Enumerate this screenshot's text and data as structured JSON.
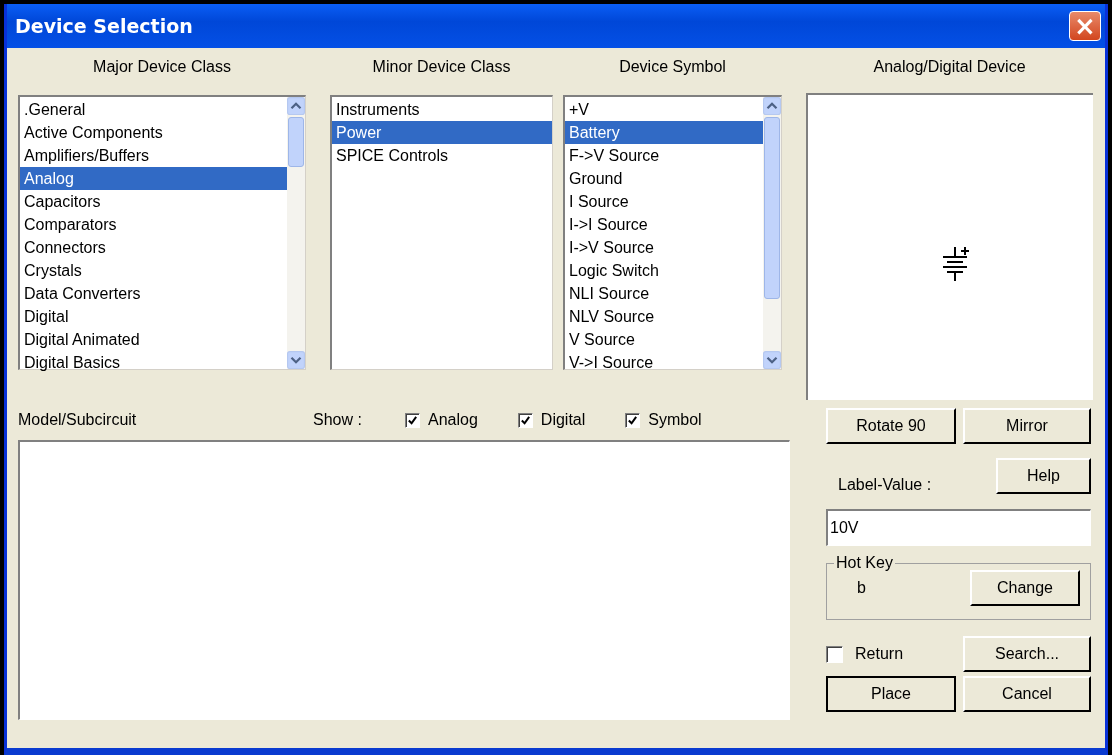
{
  "window": {
    "title": "Device Selection",
    "close": "×"
  },
  "major_device_class": {
    "heading": "Major Device Class",
    "items": [
      {
        "label": ".General",
        "selected": false
      },
      {
        "label": "Active Components",
        "selected": false
      },
      {
        "label": "Amplifiers/Buffers",
        "selected": false
      },
      {
        "label": "Analog",
        "selected": true
      },
      {
        "label": "Capacitors",
        "selected": false
      },
      {
        "label": "Comparators",
        "selected": false
      },
      {
        "label": "Connectors",
        "selected": false
      },
      {
        "label": "Crystals",
        "selected": false
      },
      {
        "label": "Data Converters",
        "selected": false
      },
      {
        "label": "Digital",
        "selected": false
      },
      {
        "label": "Digital Animated",
        "selected": false
      },
      {
        "label": "Digital Basics",
        "selected": false
      }
    ]
  },
  "minor_device_class": {
    "heading": "Minor Device Class",
    "items": [
      {
        "label": "Instruments",
        "selected": false
      },
      {
        "label": "Power",
        "selected": true
      },
      {
        "label": "SPICE Controls",
        "selected": false
      }
    ]
  },
  "device_symbol": {
    "heading": "Device Symbol",
    "items": [
      {
        "label": "+V",
        "selected": false
      },
      {
        "label": "Battery",
        "selected": true
      },
      {
        "label": "F->V Source",
        "selected": false
      },
      {
        "label": "Ground",
        "selected": false
      },
      {
        "label": "I Source",
        "selected": false
      },
      {
        "label": "I->I Source",
        "selected": false
      },
      {
        "label": "I->V Source",
        "selected": false
      },
      {
        "label": "Logic Switch",
        "selected": false
      },
      {
        "label": "NLI Source",
        "selected": false
      },
      {
        "label": "NLV Source",
        "selected": false
      },
      {
        "label": "V Source",
        "selected": false
      },
      {
        "label": "V->I Source",
        "selected": false
      }
    ]
  },
  "preview": {
    "heading": "Analog/Digital Device"
  },
  "model_subcircuit": {
    "label": "Model/Subcircuit"
  },
  "show": {
    "label": "Show :",
    "options": [
      {
        "label": "Analog",
        "checked": true
      },
      {
        "label": "Digital",
        "checked": true
      },
      {
        "label": "Symbol",
        "checked": true
      }
    ]
  },
  "buttons": {
    "rotate": "Rotate 90",
    "mirror": "Mirror",
    "help": "Help",
    "search": "Search...",
    "place": "Place",
    "cancel": "Cancel"
  },
  "label_value": {
    "label": "Label-Value :",
    "value": "10V"
  },
  "hot_key": {
    "title": "Hot Key",
    "key": "b",
    "button": "Change"
  },
  "return": {
    "label": "Return",
    "checked": false
  }
}
